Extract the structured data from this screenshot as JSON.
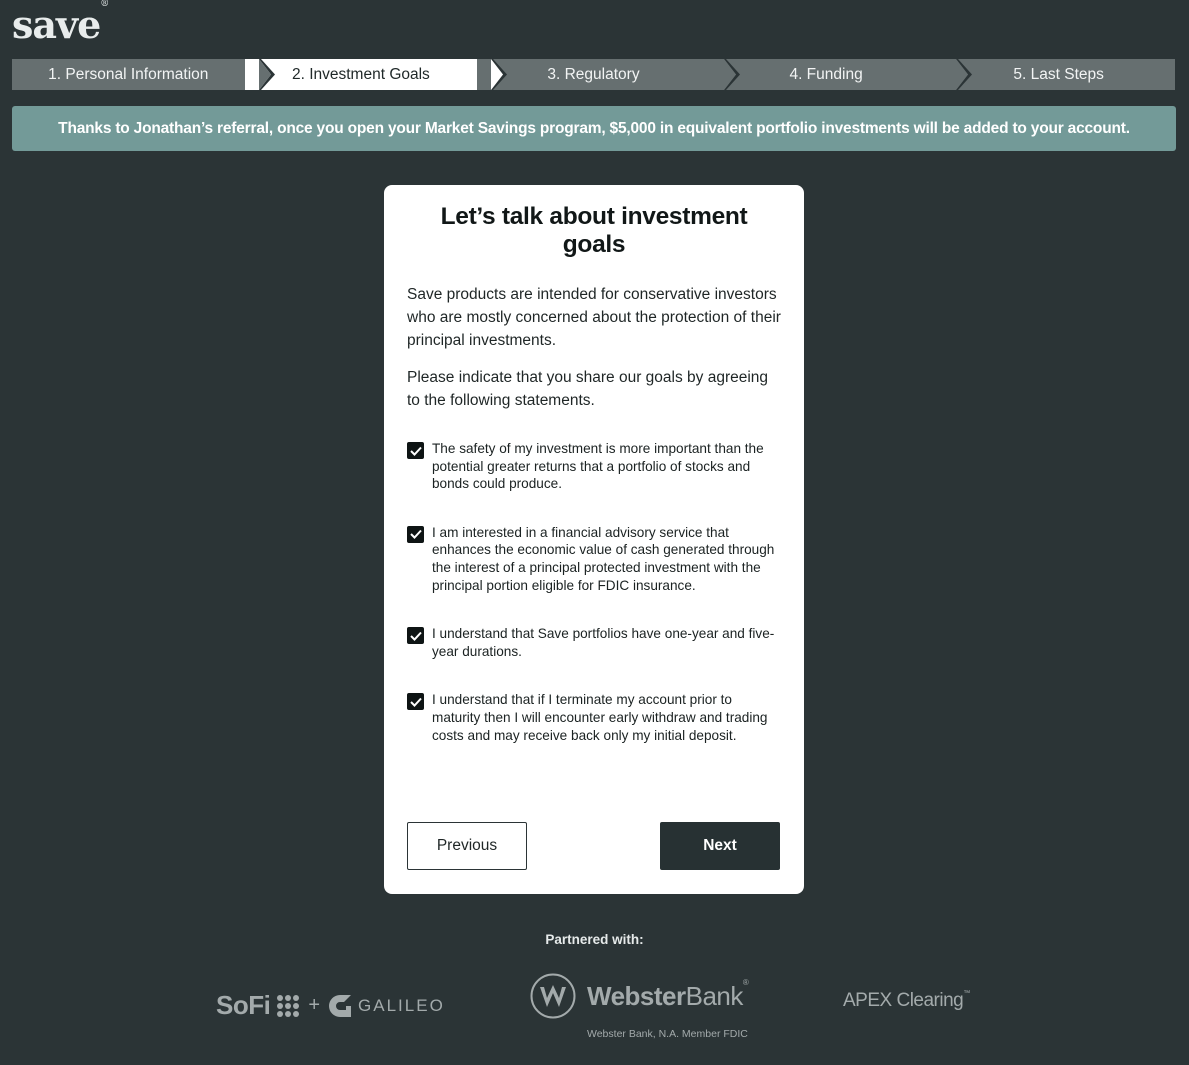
{
  "brand": {
    "logo_text": "save",
    "logo_mark": "®"
  },
  "steps": [
    {
      "label": "1. Personal Information",
      "active": false
    },
    {
      "label": "2. Investment Goals",
      "active": true
    },
    {
      "label": "3. Regulatory",
      "active": false
    },
    {
      "label": "4. Funding",
      "active": false
    },
    {
      "label": "5. Last Steps",
      "active": false
    }
  ],
  "banner": {
    "text": "Thanks to Jonathan’s referral, once you open your Market Savings program, $5,000 in equivalent portfolio investments will be added to your account."
  },
  "card": {
    "title": "Let’s talk about investment goals",
    "intro": "Save products are intended for conservative investors who are mostly concerned about the protection of their principal investments.",
    "intro2": "Please indicate that you share our goals by agreeing to the following statements.",
    "statements": [
      {
        "text": "The safety of my investment is more important than the potential greater returns that a portfolio of stocks and bonds could produce.",
        "checked": true
      },
      {
        "text": "I am interested in a financial advisory service that enhances the economic value of cash generated through the interest of a principal protected investment with the principal portion eligible for FDIC insurance.",
        "checked": true
      },
      {
        "text": "I understand that Save portfolios have one-year and five-year durations.",
        "checked": true
      },
      {
        "text": "I understand that if I terminate my account prior to maturity then I will encounter early withdraw and trading costs and may receive back only my initial deposit.",
        "checked": true
      }
    ],
    "previous_label": "Previous",
    "next_label": "Next"
  },
  "footer": {
    "partnered_label": "Partnered with:",
    "sofi_text": "SoFi",
    "plus": "+",
    "galileo_text": "GALILEO",
    "webster_name": "Webster",
    "webster_bank": "Bank",
    "webster_mark": "®",
    "webster_sub": "Webster Bank, N.A.  Member FDIC",
    "apex_text": "APEX Clearing",
    "apex_mark": "™"
  }
}
